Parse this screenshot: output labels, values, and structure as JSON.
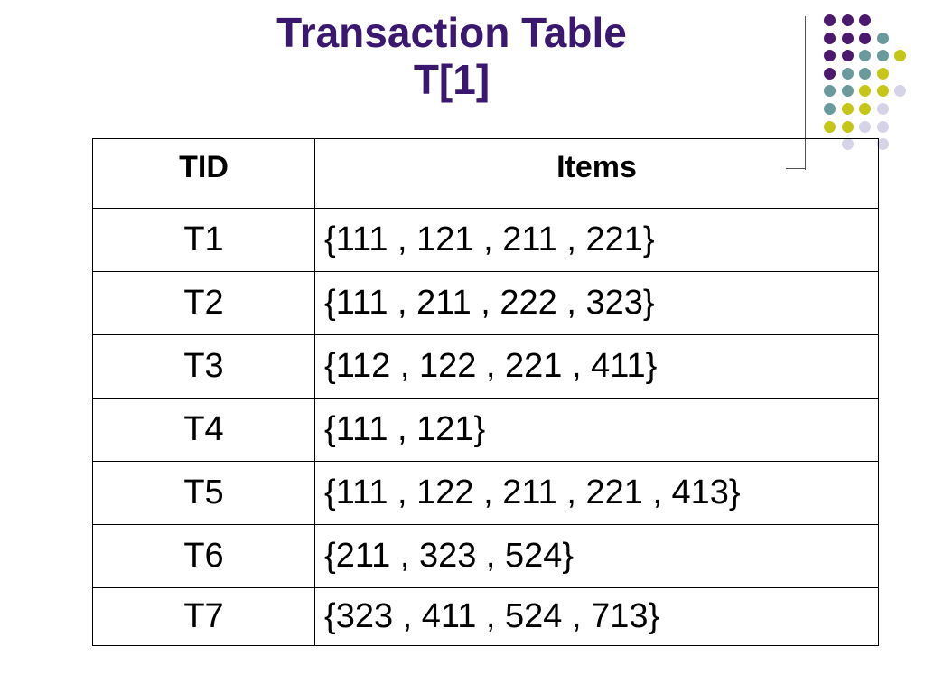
{
  "slide": {
    "title_line1": "Transaction Table",
    "title_line2": "T[1]"
  },
  "colors": {
    "title": "#3b1870",
    "dot_purple": "#4b1a6e",
    "dot_teal": "#6a9a9c",
    "dot_yellow": "#c6c619",
    "dot_lavender": "#d5d3e6"
  },
  "decoration": {
    "icon": "dot-grid-ornament"
  },
  "table": {
    "headers": [
      "TID",
      "Items"
    ],
    "rows": [
      {
        "tid": "T1",
        "items": "{111 , 121 , 211 , 221}"
      },
      {
        "tid": "T2",
        "items": "{111 , 211 , 222 , 323}"
      },
      {
        "tid": "T3",
        "items": "{112 , 122 , 221 , 411}"
      },
      {
        "tid": "T4",
        "items": "{111 , 121}"
      },
      {
        "tid": "T5",
        "items": "{111 , 122 , 211 , 221 , 413}"
      },
      {
        "tid": "T6",
        "items": "{211 , 323 , 524}"
      },
      {
        "tid": "T7",
        "items": "{323 , 411 , 524 , 713}"
      }
    ]
  }
}
